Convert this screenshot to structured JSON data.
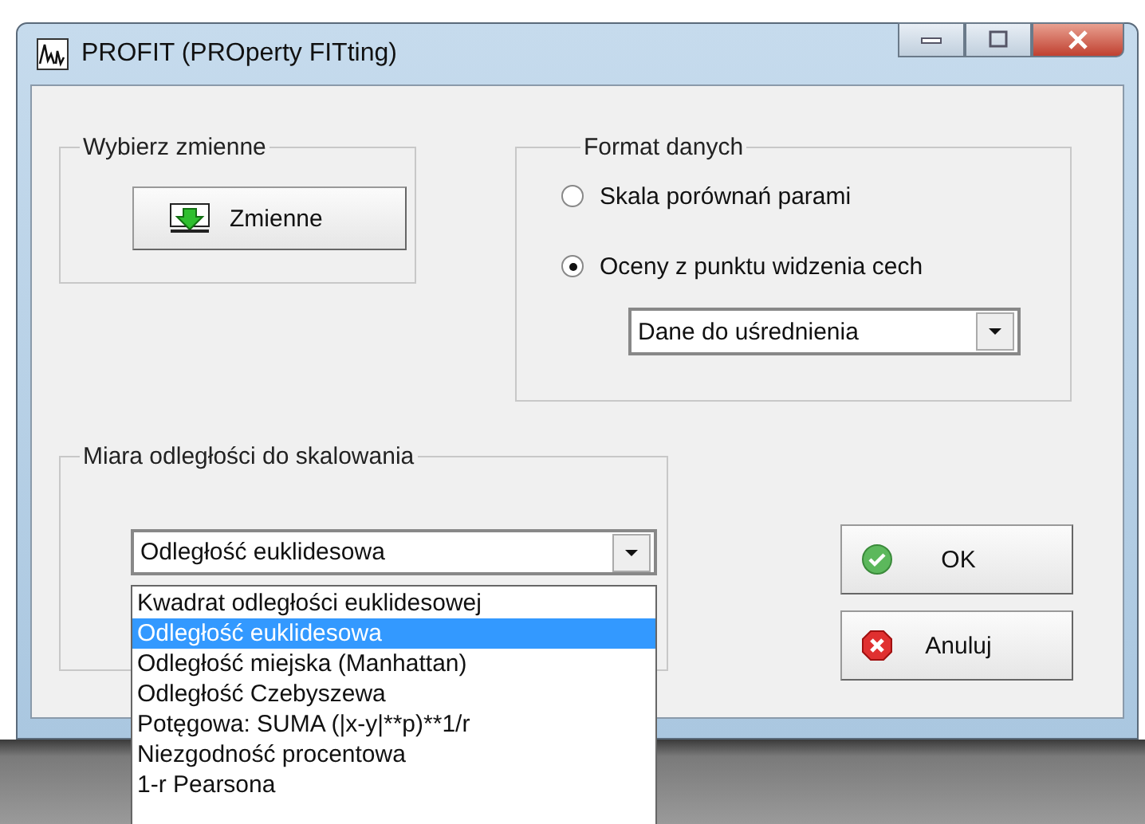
{
  "window": {
    "title": "PROFIT (PROperty FITting)"
  },
  "variables_group": {
    "title": "Wybierz zmienne",
    "button": "Zmienne"
  },
  "data_format": {
    "title": "Format danych",
    "options": [
      {
        "label": "Skala porównań parami",
        "selected": false
      },
      {
        "label": "Oceny z punktu widzenia cech",
        "selected": true
      }
    ],
    "dropdown": {
      "value": "Dane do uśrednienia"
    }
  },
  "distance": {
    "title": "Miara odległości do skalowania",
    "combo": {
      "value": "Odległość euklidesowa",
      "expanded": true
    },
    "options": [
      {
        "label": "Kwadrat odległości euklidesowej",
        "selected": false
      },
      {
        "label": "Odległość euklidesowa",
        "selected": true
      },
      {
        "label": "Odległość miejska (Manhattan)",
        "selected": false
      },
      {
        "label": "Odległość Czebyszewa",
        "selected": false
      },
      {
        "label": "Potęgowa: SUMA (|x-y|**p)**1/r",
        "selected": false
      },
      {
        "label": "Niezgodność procentowa",
        "selected": false
      },
      {
        "label": "1-r Pearsona",
        "selected": false
      }
    ]
  },
  "buttons": [
    {
      "label": "OK",
      "kind": "ok"
    },
    {
      "label": "Anuluj",
      "kind": "cancel"
    }
  ]
}
